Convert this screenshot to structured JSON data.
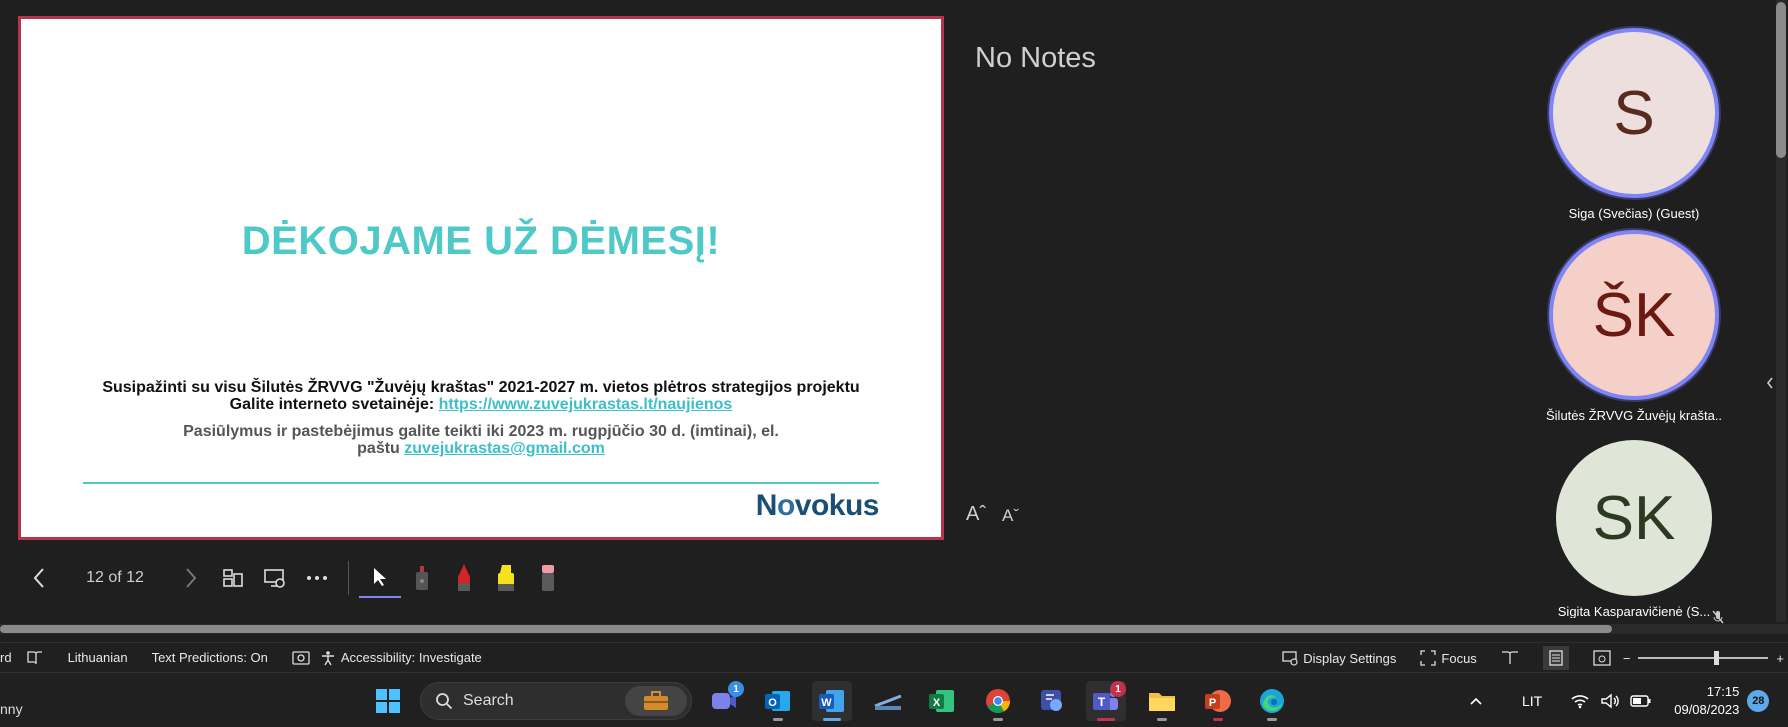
{
  "slide": {
    "title": "DĖKOJAME UŽ DĖMESĮ!",
    "line1": "Susipažinti su visu Šilutės ŽRVVG \"Žuvėjų kraštas\" 2021-2027 m. vietos plėtros strategijos projektu",
    "line2_prefix": "Galite interneto svetainėje: ",
    "line2_link": "https://www.zuvejukrastas.lt/naujienos",
    "line3": "Pasiūlymus ir pastebėjimus galite teikti  iki 2023 m. rugpjūčio 30 d. (imtinai), el.",
    "line4_prefix": "paštu ",
    "line4_link": "zuvejukrastas@gmail.com",
    "logo_part1": "N",
    "logo_o": "o",
    "logo_part2": "vokus"
  },
  "presenter_toolbar": {
    "counter": "12 of 12"
  },
  "notes": {
    "text": "No Notes",
    "font_increase": "Aˆ",
    "font_decrease": "Aˇ"
  },
  "participants": [
    {
      "initials": "S",
      "name": "Siga (Svečias) (Guest)",
      "bg": "#eedfdf",
      "fg": "#5a2a1e",
      "speaking": true
    },
    {
      "initials": "ŠK",
      "name": "Šilutės ŽRVVG Žuvėjų krašta...",
      "bg": "#f4d0c8",
      "fg": "#6a1a12",
      "speaking": true
    },
    {
      "initials": "SK",
      "name": "Sigita Kasparavičienė (S...",
      "bg": "#dfe6d8",
      "fg": "#2c3a22",
      "speaking": false
    }
  ],
  "statusbar": {
    "left_partial": "rd",
    "language": "Lithuanian",
    "text_predictions": "Text Predictions: On",
    "accessibility": "Accessibility: Investigate",
    "display_settings": "Display Settings",
    "focus": "Focus",
    "zoom_minus": "−",
    "zoom_plus": "+"
  },
  "taskbar": {
    "left_partial": "nny",
    "search_placeholder": "Search",
    "chat_badge": "1",
    "teams_badge": "1",
    "language": "LIT",
    "time": "17:15",
    "date": "09/08/2023",
    "notification_count": "28"
  },
  "colors": {
    "accent": "#7f85f5",
    "slide_border": "#b8344c",
    "teal": "#4fc8c8"
  }
}
